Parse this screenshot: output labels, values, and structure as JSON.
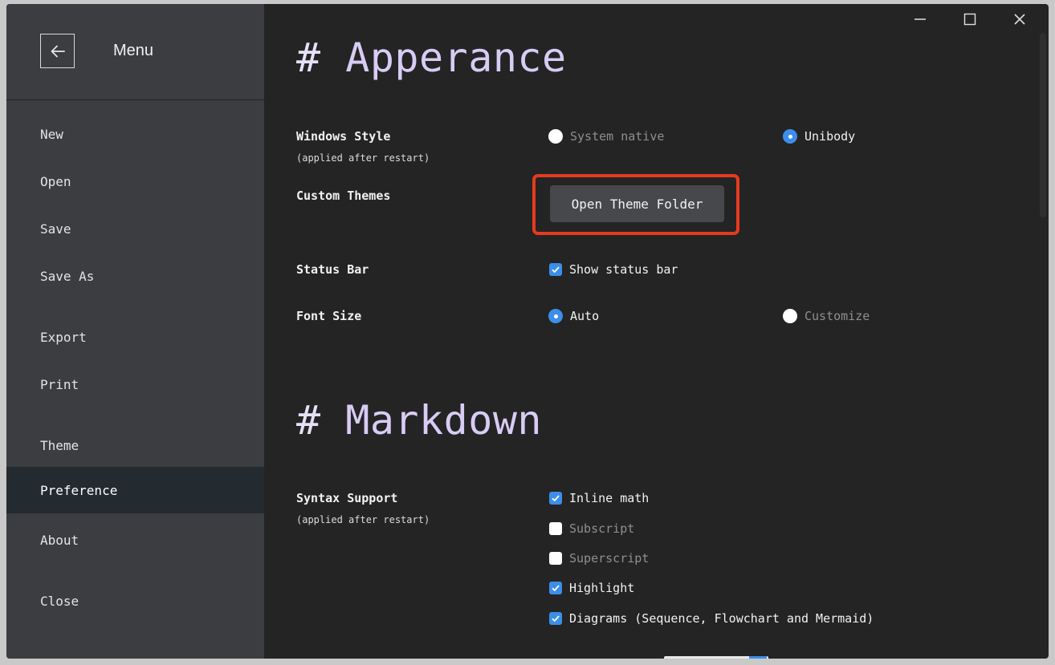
{
  "sidebar": {
    "title": "Menu",
    "items": [
      {
        "label": "New"
      },
      {
        "label": "Open"
      },
      {
        "label": "Save"
      },
      {
        "label": "Save As"
      },
      {
        "label": "Export"
      },
      {
        "label": "Print"
      },
      {
        "label": "Theme"
      },
      {
        "label": "Preference"
      },
      {
        "label": "About"
      },
      {
        "label": "Close"
      }
    ],
    "active": "Preference"
  },
  "appearance": {
    "heading_hash": "#",
    "heading": "Apperance",
    "windows_style": {
      "label": "Windows Style",
      "note": "(applied after restart)",
      "options": [
        {
          "label": "System native",
          "selected": false
        },
        {
          "label": "Unibody",
          "selected": true
        }
      ]
    },
    "custom_themes": {
      "label": "Custom Themes",
      "button": "Open Theme Folder"
    },
    "status_bar": {
      "label": "Status Bar",
      "option": {
        "label": "Show status bar",
        "checked": true
      }
    },
    "font_size": {
      "label": "Font Size",
      "options": [
        {
          "label": "Auto",
          "selected": true
        },
        {
          "label": "Customize",
          "selected": false
        }
      ]
    }
  },
  "markdown": {
    "heading_hash": "#",
    "heading": "Markdown",
    "syntax_support": {
      "label": "Syntax Support",
      "note": "(applied after restart)",
      "options": [
        {
          "label": "Inline math",
          "checked": true
        },
        {
          "label": "Subscript",
          "checked": false
        },
        {
          "label": "Superscript",
          "checked": false
        },
        {
          "label": "Highlight",
          "checked": true
        },
        {
          "label": "Diagrams (Sequence, Flowchart and Mermaid)",
          "checked": true
        }
      ]
    }
  },
  "colors": {
    "accent": "#3d8eea",
    "heading": "#d8ccf5",
    "highlight_box": "#e63a1f"
  }
}
